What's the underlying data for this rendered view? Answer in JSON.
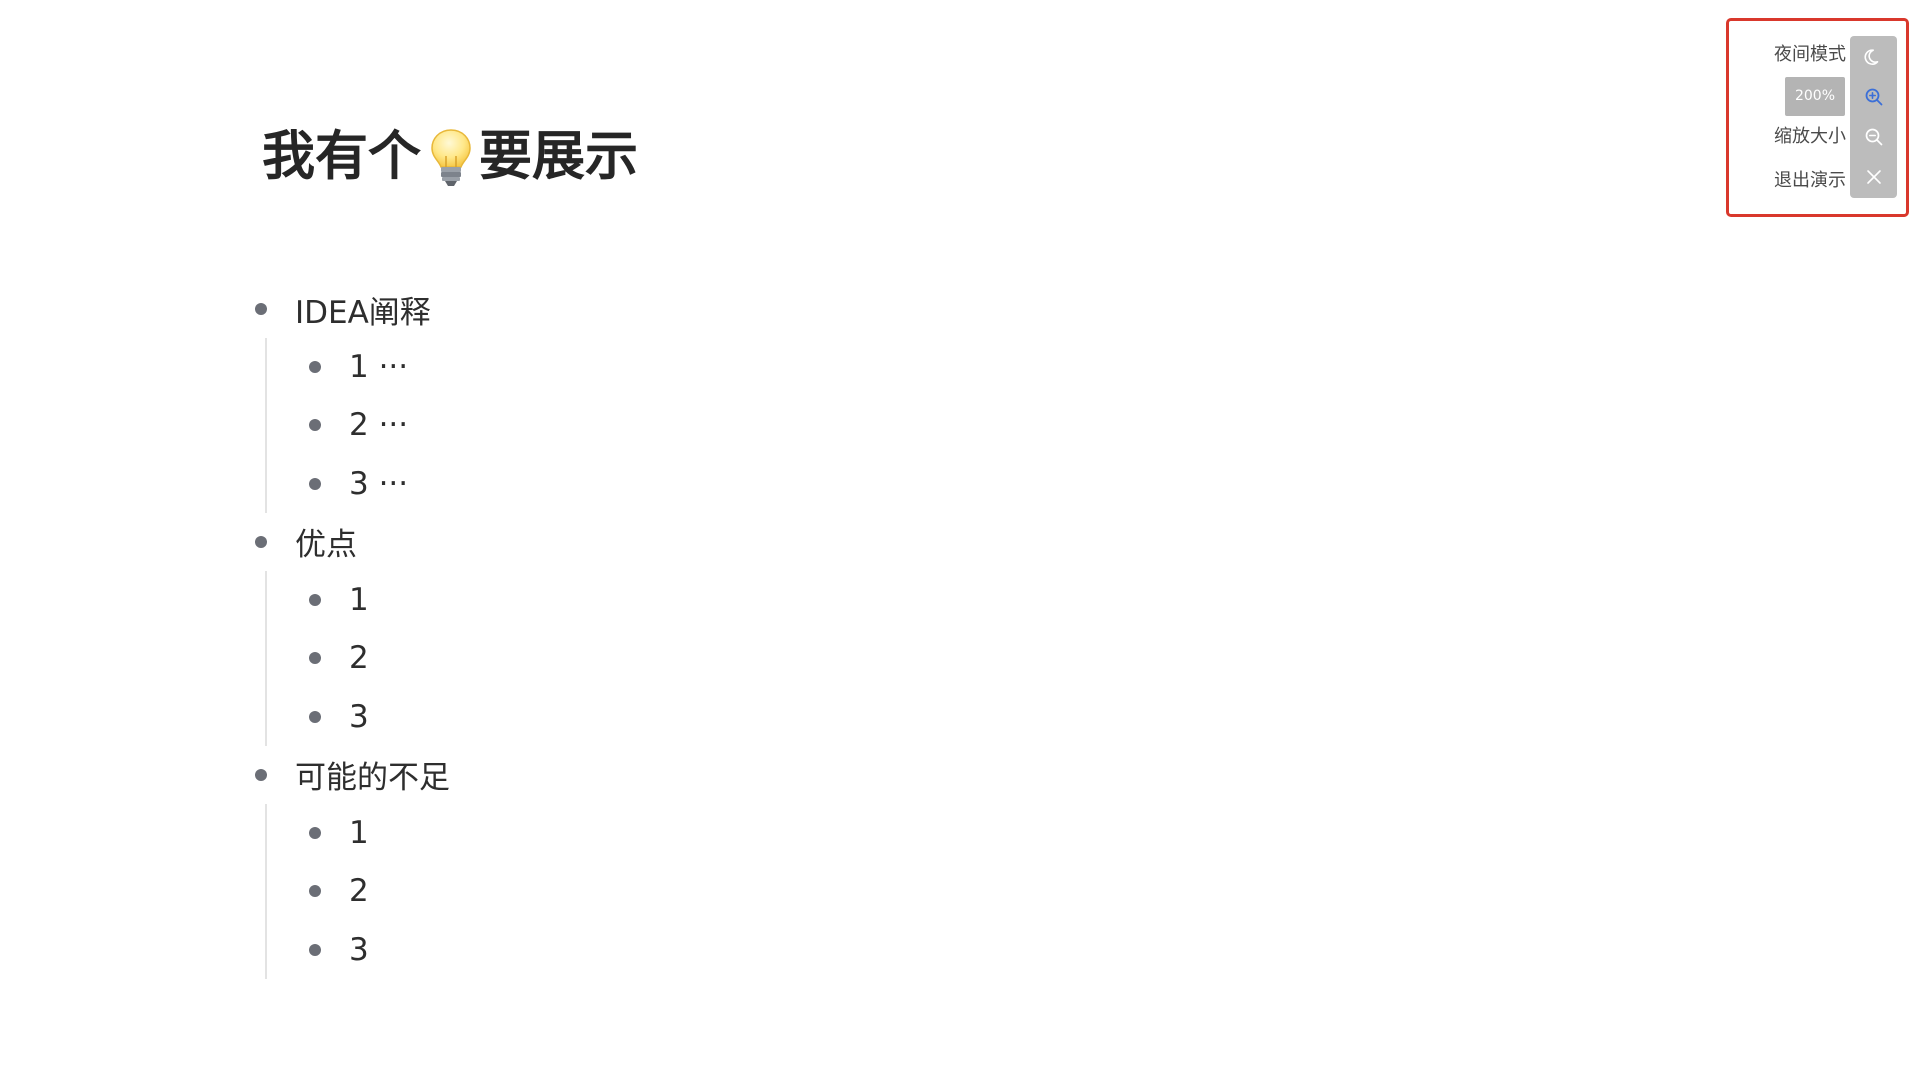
{
  "page": {
    "title_before": "我有个",
    "title_after": "要展示",
    "title_icon": "lightbulb-icon"
  },
  "outline": [
    {
      "label": "IDEA阐释",
      "children": [
        "1 ···",
        "2 ···",
        "3 ···"
      ]
    },
    {
      "label": "优点",
      "children": [
        "1",
        "2",
        "3"
      ]
    },
    {
      "label": "可能的不足",
      "children": [
        "1",
        "2",
        "3"
      ]
    }
  ],
  "controls": {
    "night_mode_label": "夜间模式",
    "zoom_value": "200%",
    "zoom_label": "缩放大小",
    "exit_label": "退出演示",
    "icons": [
      "moon-icon",
      "zoom-in-icon",
      "zoom-out-icon",
      "close-icon"
    ],
    "zoom_in_active_color": "#3b6fd8",
    "highlight_border_color": "#d9382c"
  }
}
